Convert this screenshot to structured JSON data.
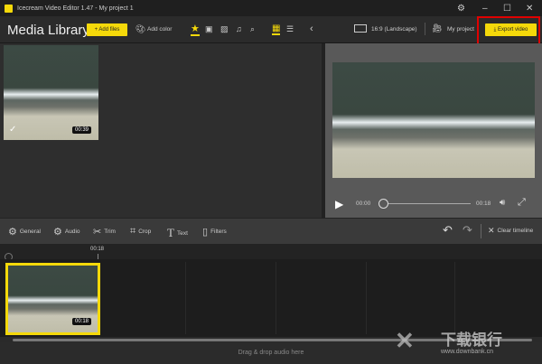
{
  "window": {
    "title": "Icecream Video Editor 1.47  -  My project 1"
  },
  "toolbar": {
    "heading": "Media Library",
    "add_files": "+ Add files",
    "add_color": "Add color",
    "aspect": "16:9 (Landscape)",
    "project": "My project",
    "export": "Export video"
  },
  "media": [
    {
      "duration": "00:39",
      "selected": true
    }
  ],
  "player": {
    "current": "00:00",
    "total": "00:18",
    "progress": 0
  },
  "edit_tools": [
    "General",
    "Audio",
    "Trim",
    "Crop",
    "Text",
    "Filters"
  ],
  "clear_timeline": "Clear timeline",
  "timeline": {
    "marker": "00:18",
    "clip_duration": "00:18"
  },
  "audio_drop": "Drag & drop audio here",
  "watermark": {
    "name": "下载银行",
    "url": "www.downbank.cn"
  },
  "colors": {
    "accent": "#f5d90a",
    "highlight": "#e00000"
  }
}
